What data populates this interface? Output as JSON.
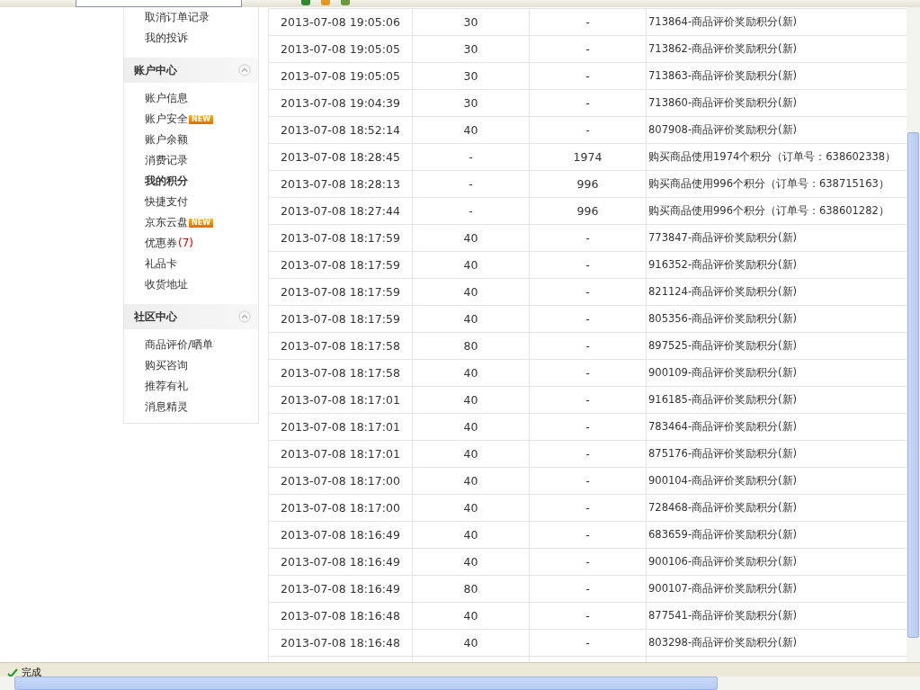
{
  "sidebar": {
    "top_items": [
      {
        "label": "取消订单记录"
      },
      {
        "label": "我的投诉"
      }
    ],
    "sections": [
      {
        "title": "账户中心",
        "expanded": true,
        "items": [
          {
            "label": "账户信息",
            "selected": false
          },
          {
            "label": "账户安全",
            "selected": false,
            "badge": "NEW"
          },
          {
            "label": "账户余额",
            "selected": false
          },
          {
            "label": "消费记录",
            "selected": false
          },
          {
            "label": "我的积分",
            "selected": true
          },
          {
            "label": "快捷支付",
            "selected": false
          },
          {
            "label": "京东云盘",
            "selected": false,
            "badge": "NEW"
          },
          {
            "label": "优惠券",
            "selected": false,
            "count": "(7)"
          },
          {
            "label": "礼品卡",
            "selected": false
          },
          {
            "label": "收货地址",
            "selected": false
          }
        ]
      },
      {
        "title": "社区中心",
        "expanded": true,
        "items": [
          {
            "label": "商品评价/晒单",
            "selected": false
          },
          {
            "label": "购买咨询",
            "selected": false
          },
          {
            "label": "推荐有礼",
            "selected": false
          },
          {
            "label": "消息精灵",
            "selected": false
          }
        ]
      }
    ]
  },
  "table": {
    "rows": [
      [
        "2013-07-08 19:05:06",
        "30",
        "-",
        "713864-商品评价奖励积分(新)"
      ],
      [
        "2013-07-08 19:05:05",
        "30",
        "-",
        "713862-商品评价奖励积分(新)"
      ],
      [
        "2013-07-08 19:05:05",
        "30",
        "-",
        "713863-商品评价奖励积分(新)"
      ],
      [
        "2013-07-08 19:04:39",
        "30",
        "-",
        "713860-商品评价奖励积分(新)"
      ],
      [
        "2013-07-08 18:52:14",
        "40",
        "-",
        "807908-商品评价奖励积分(新)"
      ],
      [
        "2013-07-08 18:28:45",
        "-",
        "1974",
        "购买商品使用1974个积分（订单号：638602338）"
      ],
      [
        "2013-07-08 18:28:13",
        "-",
        "996",
        "购买商品使用996个积分（订单号：638715163）"
      ],
      [
        "2013-07-08 18:27:44",
        "-",
        "996",
        "购买商品使用996个积分（订单号：638601282）"
      ],
      [
        "2013-07-08 18:17:59",
        "40",
        "-",
        "773847-商品评价奖励积分(新)"
      ],
      [
        "2013-07-08 18:17:59",
        "40",
        "-",
        "916352-商品评价奖励积分(新)"
      ],
      [
        "2013-07-08 18:17:59",
        "40",
        "-",
        "821124-商品评价奖励积分(新)"
      ],
      [
        "2013-07-08 18:17:59",
        "40",
        "-",
        "805356-商品评价奖励积分(新)"
      ],
      [
        "2013-07-08 18:17:58",
        "80",
        "-",
        "897525-商品评价奖励积分(新)"
      ],
      [
        "2013-07-08 18:17:58",
        "40",
        "-",
        "900109-商品评价奖励积分(新)"
      ],
      [
        "2013-07-08 18:17:01",
        "40",
        "-",
        "916185-商品评价奖励积分(新)"
      ],
      [
        "2013-07-08 18:17:01",
        "40",
        "-",
        "783464-商品评价奖励积分(新)"
      ],
      [
        "2013-07-08 18:17:01",
        "40",
        "-",
        "875176-商品评价奖励积分(新)"
      ],
      [
        "2013-07-08 18:17:00",
        "40",
        "-",
        "900104-商品评价奖励积分(新)"
      ],
      [
        "2013-07-08 18:17:00",
        "40",
        "-",
        "728468-商品评价奖励积分(新)"
      ],
      [
        "2013-07-08 18:16:49",
        "40",
        "-",
        "683659-商品评价奖励积分(新)"
      ],
      [
        "2013-07-08 18:16:49",
        "40",
        "-",
        "900106-商品评价奖励积分(新)"
      ],
      [
        "2013-07-08 18:16:49",
        "80",
        "-",
        "900107-商品评价奖励积分(新)"
      ],
      [
        "2013-07-08 18:16:48",
        "40",
        "-",
        "877541-商品评价奖励积分(新)"
      ],
      [
        "2013-07-08 18:16:48",
        "40",
        "-",
        "803298-商品评价奖励积分(新)"
      ]
    ]
  },
  "status_bar": {
    "text": "完成"
  }
}
